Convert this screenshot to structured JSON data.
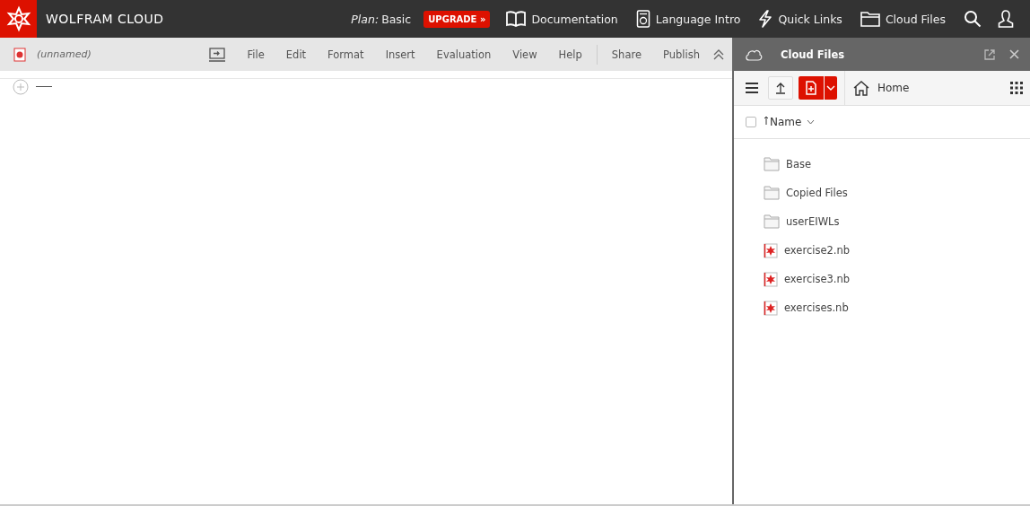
{
  "brand": "WOLFRAM CLOUD",
  "plan_label": "Plan:",
  "plan": "Basic",
  "upgrade": "UPGRADE »",
  "nav": [
    {
      "kind": "book",
      "label": "Documentation"
    },
    {
      "kind": "device",
      "label": "Language Intro"
    },
    {
      "kind": "bolt",
      "label": "Quick Links"
    },
    {
      "kind": "folder",
      "label": "Cloud Files"
    }
  ],
  "notebook": {
    "title": "(unnamed)",
    "menu": [
      "File",
      "Edit",
      "Format",
      "Insert",
      "Evaluation",
      "View",
      "Help"
    ],
    "actions": [
      "Share",
      "Publish"
    ]
  },
  "panel": {
    "title": "Cloud Files",
    "location": "Home",
    "select_all": {
      "checked": false
    },
    "sort_column": "Name",
    "files": [
      {
        "kind": "folder",
        "name": "Base"
      },
      {
        "kind": "folder",
        "name": "Copied Files"
      },
      {
        "kind": "folder",
        "name": "userEIWLs"
      },
      {
        "kind": "notebook",
        "name": "exercise2.nb"
      },
      {
        "kind": "notebook",
        "name": "exercise3.nb"
      },
      {
        "kind": "notebook",
        "name": "exercises.nb"
      }
    ]
  }
}
